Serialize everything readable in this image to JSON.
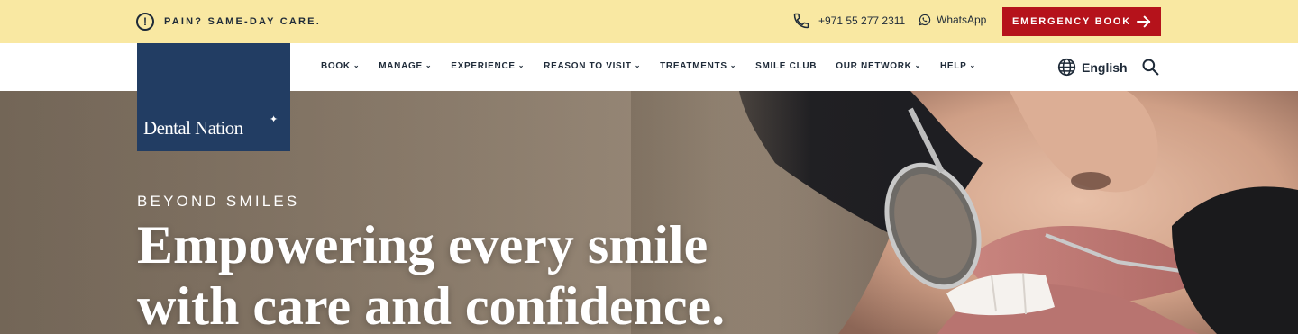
{
  "topbar": {
    "notice_icon": "exclamation-circle-icon",
    "notice": "PAIN? SAME-DAY CARE.",
    "phone_icon": "phone-icon",
    "phone": "+971 55 277 2311",
    "whatsapp_icon": "whatsapp-icon",
    "whatsapp": "WhatsApp",
    "emergency_button": "EMERGENCY BOOK",
    "emergency_icon": "arrow-right-icon",
    "background": "#f9e8a2",
    "emergency_color": "#b5121b"
  },
  "logo": {
    "text": "Dental Nation",
    "mark": "✦",
    "background": "#223d63"
  },
  "nav": {
    "items": [
      {
        "label": "BOOK",
        "dropdown": "⌄"
      },
      {
        "label": "MANAGE",
        "dropdown": "⌄"
      },
      {
        "label": "EXPERIENCE",
        "dropdown": "⌄"
      },
      {
        "label": "REASON TO VISIT",
        "dropdown": "⌄"
      },
      {
        "label": "TREATMENTS",
        "dropdown": "⌄"
      },
      {
        "label": "SMILE CLUB",
        "dropdown": ""
      },
      {
        "label": "OUR NETWORK",
        "dropdown": "⌄"
      },
      {
        "label": "HELP",
        "dropdown": "⌄"
      }
    ],
    "language_icon": "globe-icon",
    "language": "English",
    "search_icon": "search-icon"
  },
  "hero": {
    "eyebrow": "BEYOND SMILES",
    "headline_line1": "Empowering every smile",
    "headline_line2": "with care and confidence."
  }
}
